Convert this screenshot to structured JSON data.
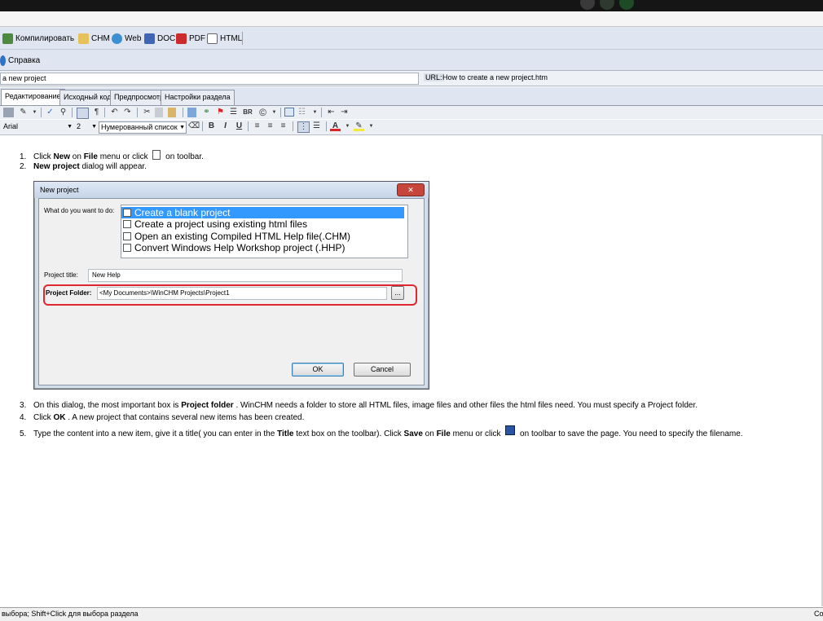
{
  "toolbar": {
    "compile_label": "Компилировать",
    "chm_label": "CHM",
    "web_label": "Web",
    "doc_label": "DOC",
    "pdf_label": "PDF",
    "html_label": "HTML",
    "help_label": "Справка"
  },
  "url_row": {
    "title_value": "a new project",
    "url_label": "URL:",
    "url_value": "How to create a new project.htm"
  },
  "tabs": [
    "Редактирование",
    "Исходный код",
    "Предпросмотр",
    "Настройки раздела"
  ],
  "format": {
    "font": "Arial",
    "size": "2",
    "list_style": "Нумерованный список",
    "bold": "B",
    "italic": "I",
    "underline": "U",
    "br": "BR",
    "copyright": "©"
  },
  "content": {
    "step1": {
      "num": "1.",
      "a": "Click ",
      "b": "New",
      "c": " on ",
      "d": "File",
      "e": " menu or click ",
      "f": " on toolbar."
    },
    "step2": {
      "num": "2.",
      "a": "New project",
      "b": " dialog will appear."
    },
    "step3": {
      "num": "3.",
      "a": "On this dialog, the most important box is ",
      "b": "Project folder",
      "c": " . WinCHM needs a folder to store all HTML files, image files and other files the html files need. You must specify a Project folder."
    },
    "step4": {
      "num": "4.",
      "a": "Click ",
      "b": "OK",
      "c": " . A new project that contains several new items has been created."
    },
    "step5": {
      "num": "5.",
      "a": "Type the content into a new item, give it a title( you can enter in the ",
      "b": "Title",
      "c": " text box on the toolbar). Click ",
      "d": "Save",
      "e": " on ",
      "f": "File",
      "g": " menu or click ",
      "h": " on toolbar to save the page. You need to specify the filename."
    }
  },
  "dialog": {
    "title": "New project",
    "prompt": "What do you want to do:",
    "options": [
      {
        "label": "Create a blank project",
        "checked": "☑",
        "selected": true
      },
      {
        "label": "Create a project using existing html files",
        "checked": ""
      },
      {
        "label": "Open an existing Compiled HTML Help file(.CHM)",
        "checked": ""
      },
      {
        "label": "Convert Windows Help Workshop project (.HHP)",
        "checked": ""
      }
    ],
    "project_title_label": "Project title:",
    "project_title_value": "New Help",
    "project_folder_label": "Project Folder:",
    "project_folder_value": "<My Documents>\\WinCHM Projects\\Project1",
    "browse_label": "...",
    "ok_label": "OK",
    "cancel_label": "Cancel"
  },
  "status": {
    "left": "выбора; Shift+Click для выбора раздела",
    "right": "Co"
  },
  "colors": {
    "highlight": "#3399ff",
    "folder_outline": "#e0262e",
    "toolbar_bg": "#dfe6f1"
  }
}
